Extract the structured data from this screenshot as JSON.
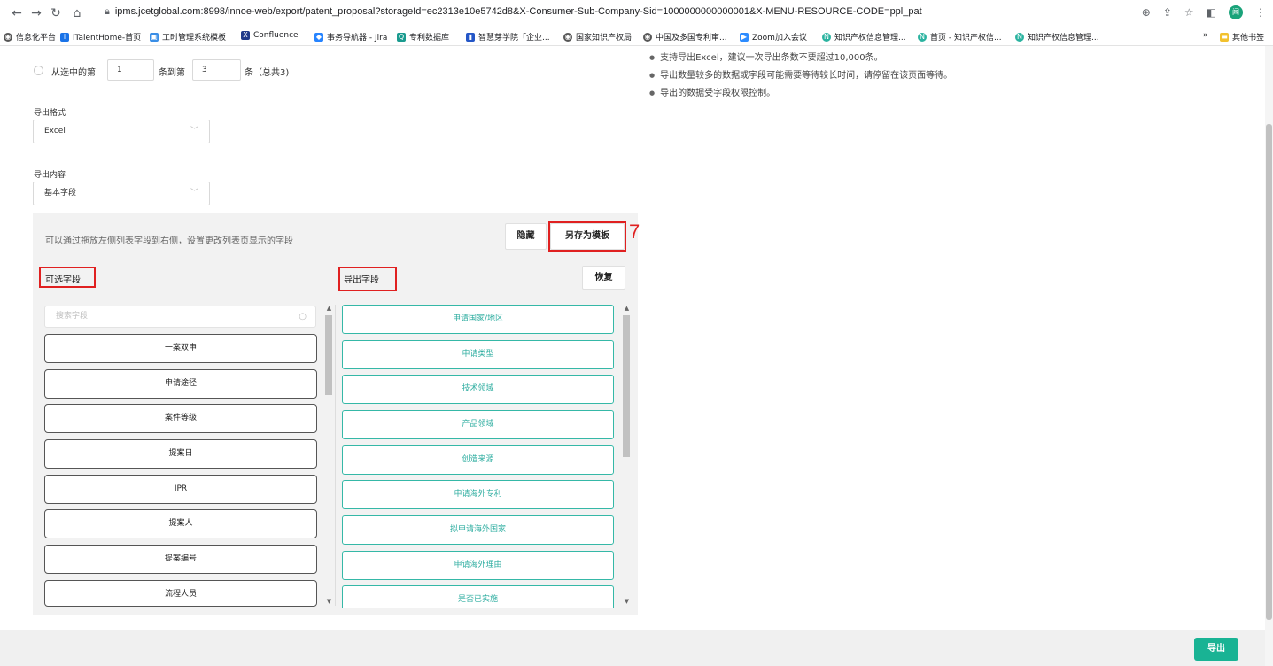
{
  "browser": {
    "url": "ipms.jcetglobal.com:8998/innoe-web/export/patent_proposal?storageId=ec2313e10e5742d8&X-Consumer-Sub-Company-Sid=1000000000000001&X-MENU-RESOURCE-CODE=ppl_pat",
    "bookmarks": [
      "信息化平台",
      "iTalentHome-首页",
      "工时管理系统模板",
      "Confluence",
      "事务导航器 - Jira",
      "专利数据库",
      "智慧芽学院「企业...",
      "国家知识产权局",
      "中国及多国专利审...",
      "Zoom加入会议",
      "知识产权信息管理...",
      "首页 - 知识产权信...",
      "知识产权信息管理..."
    ],
    "more_bookmarks": "»",
    "other_bookmarks": "其他书签",
    "profile_initial": "闻"
  },
  "range": {
    "prefix": "从选中的第",
    "from": "1",
    "middle": "条到第",
    "to": "3",
    "suffix": "条（总共3)"
  },
  "format": {
    "label": "导出格式",
    "value": "Excel"
  },
  "content": {
    "label": "导出内容",
    "value": "基本字段"
  },
  "notes": [
    "支持导出Excel，建议一次导出条数不要超过10,000条。",
    "导出数量较多的数据或字段可能需要等待较长时间，请停留在该页面等待。",
    "导出的数据受字段权限控制。"
  ],
  "panel": {
    "hint": "可以通过拖放左侧列表字段到右侧，设置更改列表页显示的字段",
    "hide_label": "隐藏",
    "save_template_label": "另存为模板",
    "annotation": "7",
    "available_title": "可选字段",
    "export_title": "导出字段",
    "restore_label": "恢复",
    "search_placeholder": "搜索字段",
    "available_fields": [
      "一案双申",
      "申请途径",
      "案件等级",
      "提案日",
      "IPR",
      "提案人",
      "提案编号",
      "流程人员"
    ],
    "export_fields": [
      "申请国家/地区",
      "申请类型",
      "技术领域",
      "产品领域",
      "创造来源",
      "申请海外专利",
      "拟申请海外国家",
      "申请海外理由",
      "是否已实施"
    ]
  },
  "footer": {
    "export_label": "导出"
  },
  "colors": {
    "accent": "#19b394",
    "field_border": "#35b8a7",
    "annotation": "#e02020"
  }
}
